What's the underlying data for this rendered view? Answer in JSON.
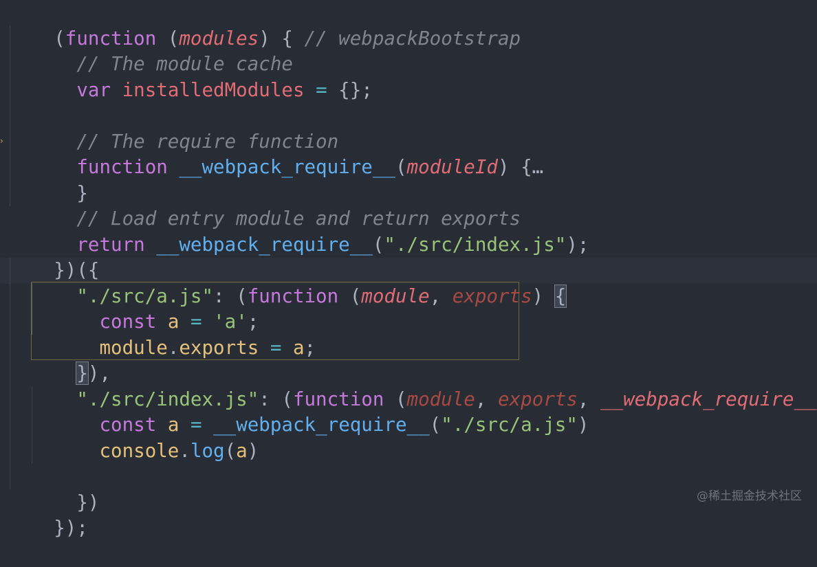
{
  "editor": {
    "lines": [
      {
        "tokens": [
          "(",
          "function",
          " (",
          "modules",
          ") { ",
          "// webpackBootstrap"
        ]
      },
      {
        "tokens": [
          "  ",
          "// The module cache"
        ]
      },
      {
        "tokens": [
          "  ",
          "var",
          " ",
          "installedModules",
          " ",
          "=",
          " {};"
        ]
      },
      {
        "tokens": [
          ""
        ]
      },
      {
        "tokens": [
          "  ",
          "// The require function"
        ]
      },
      {
        "tokens": [
          "  ",
          "function",
          " ",
          "__webpack_require__",
          "(",
          "moduleId",
          ") {",
          "…"
        ]
      },
      {
        "tokens": [
          "  }"
        ]
      },
      {
        "tokens": [
          "  ",
          "// Load entry module and return exports"
        ]
      },
      {
        "tokens": [
          "  ",
          "return",
          " ",
          "__webpack_require__",
          "(",
          "\"./src/index.js\"",
          ");"
        ]
      },
      {
        "tokens": [
          "})({"
        ]
      },
      {
        "tokens": [
          "  ",
          "\"./src/a.js\"",
          ": (",
          "function",
          " (",
          "module",
          ", ",
          "exports",
          ") ",
          "{"
        ]
      },
      {
        "tokens": [
          "    ",
          "const",
          " ",
          "a",
          " ",
          "=",
          " ",
          "'a'",
          ";"
        ]
      },
      {
        "tokens": [
          "    ",
          "module",
          ".",
          "exports",
          " ",
          "=",
          " ",
          "a",
          ";"
        ]
      },
      {
        "tokens": [
          "  ",
          "}",
          "),"
        ]
      },
      {
        "tokens": [
          "  ",
          "\"./src/index.js\"",
          ": (",
          "function",
          " (",
          "module",
          ", ",
          "exports",
          ", ",
          "__webpack_require__",
          ") {"
        ]
      },
      {
        "tokens": [
          "    ",
          "const",
          " ",
          "a",
          " ",
          "=",
          " ",
          "__webpack_require__",
          "(",
          "\"./src/a.js\"",
          ")"
        ]
      },
      {
        "tokens": [
          "    ",
          "console",
          ".",
          "log",
          "(",
          "a",
          ")"
        ]
      },
      {
        "tokens": [
          ""
        ]
      },
      {
        "tokens": [
          "  })"
        ]
      },
      {
        "tokens": [
          "});"
        ]
      }
    ]
  },
  "watermark": "@稀土掘金技术社区",
  "colors": {
    "background": "#282c34",
    "keyword": "#c678dd",
    "function": "#61afef",
    "parameter": "#e06c75",
    "comment": "#7f848e",
    "string": "#98c379",
    "operator": "#56b6c2",
    "property": "#e5c07b"
  },
  "icons": {
    "fold": "fold-arrow-icon"
  }
}
